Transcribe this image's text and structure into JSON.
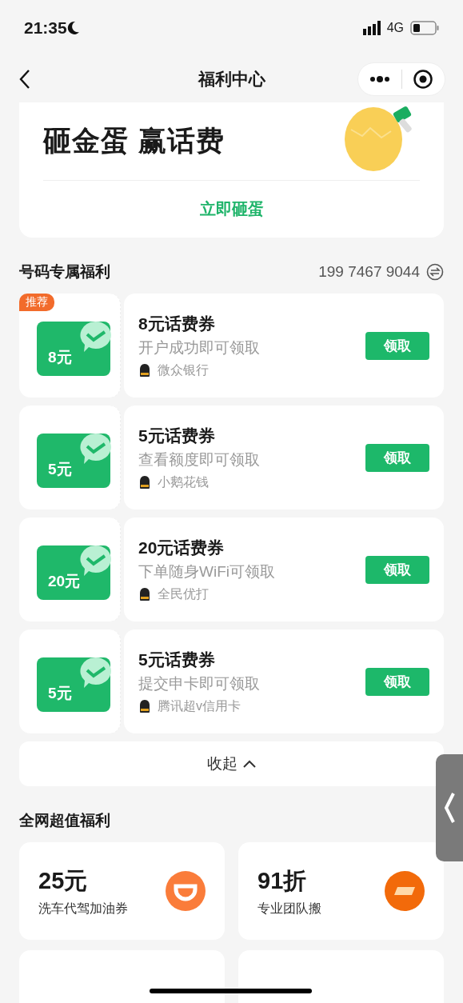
{
  "status_bar": {
    "time": "21:35",
    "network": "4G"
  },
  "nav": {
    "title": "福利中心"
  },
  "banner": {
    "title": "砸金蛋 赢话费",
    "action": "立即砸蛋"
  },
  "exclusive": {
    "title": "号码专属福利",
    "phone": "199 7467 9044",
    "coupons": [
      {
        "tag": "推荐",
        "amount": "8元",
        "title": "8元话费券",
        "condition": "开户成功即可领取",
        "provider": "微众银行",
        "button": "领取"
      },
      {
        "amount": "5元",
        "title": "5元话费券",
        "condition": "查看额度即可领取",
        "provider": "小鹅花钱",
        "button": "领取"
      },
      {
        "amount": "20元",
        "title": "20元话费券",
        "condition": "下单随身WiFi可领取",
        "provider": "全民优打",
        "button": "领取"
      },
      {
        "amount": "5元",
        "title": "5元话费券",
        "condition": "提交申卡即可领取",
        "provider": "腾讯超v信用卡",
        "button": "领取"
      }
    ],
    "collapse": "收起"
  },
  "deals": {
    "title": "全网超值福利",
    "items": [
      {
        "kind": "ride",
        "value": "25元",
        "desc": "洗车代驾加油券"
      },
      {
        "kind": "moving",
        "value": "91折",
        "desc": "专业团队搬"
      }
    ]
  }
}
